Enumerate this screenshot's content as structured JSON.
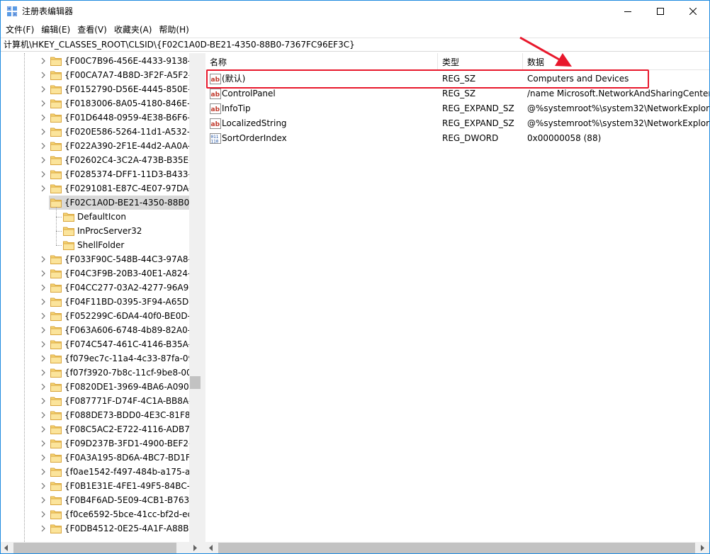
{
  "window": {
    "title": "注册表编辑器",
    "controls": {
      "minimize": "minimize-icon",
      "maximize": "maximize-icon",
      "close": "close-icon"
    }
  },
  "menu": [
    "文件(F)",
    "编辑(E)",
    "查看(V)",
    "收藏夹(A)",
    "帮助(H)"
  ],
  "address": "计算机\\HKEY_CLASSES_ROOT\\CLSID\\{F02C1A0D-BE21-4350-88B0-7367FC96EF3C}",
  "tree": {
    "before": [
      "{F00C7B96-456E-4433-9138-5",
      "{F00CA7A7-4B8D-3F2F-A5F2-C",
      "{F0152790-D56E-4445-850E-4I",
      "{F0183006-8A05-4180-846E-0/",
      "{F01D6448-0959-4E38-B6F6-B",
      "{F020E586-5264-11d1-A532-00",
      "{F022A390-2F1E-44d2-AA0A-0",
      "{F02602C4-3C2A-473B-B35E-6",
      "{F0285374-DFF1-11D3-B433-00",
      "{F0291081-E87C-4E07-97DA-A"
    ],
    "selected": "{F02C1A0D-BE21-4350-88B0-7",
    "children": [
      "DefaultIcon",
      "InProcServer32",
      "ShellFolder"
    ],
    "after": [
      "{F033F90C-548B-44C3-97A8-B",
      "{F04C3F9B-20B3-40E1-A824-3/",
      "{F04CC277-03A2-4277-96A9-7",
      "{F04F11BD-0395-3F94-A65D-C",
      "{F052299C-6DA4-40f0-BE0D-8",
      "{F063A606-6748-4b89-82A0-3I",
      "{F074C547-461C-4146-B35A-F",
      "{f079ec7c-11a4-4c33-87fa-090",
      "{f07f3920-7b8c-11cf-9be8-00a",
      "{F0820DE1-3969-4BA6-A090-E",
      "{F087771F-D74F-4C1A-BB8A-E",
      "{F088DE73-BDD0-4E3C-81F8-6",
      "{F08C5AC2-E722-4116-ADB7-C",
      "{F09D237B-3FD1-4900-BEF2-3/",
      "{F0A3A195-8D6A-4BC7-BD1F-3",
      "{f0ae1542-f497-484b-a175-a2",
      "{F0B1E31E-4FE1-49F5-84BC-4E",
      "{F0B4F6AD-5E09-4CB1-B763-E",
      "{f0ce6592-5bce-41cc-bf2d-ec4",
      "{F0DB4512-0E25-4A1F-A88B-8"
    ]
  },
  "columns": {
    "name": "名称",
    "type": "类型",
    "data": "数据"
  },
  "values": [
    {
      "name": "(默认)",
      "type": "REG_SZ",
      "data": "Computers and Devices",
      "icon": "string-value-icon"
    },
    {
      "name": "ControlPanel",
      "type": "REG_SZ",
      "data": "/name Microsoft.NetworkAndSharingCenter",
      "icon": "string-value-icon"
    },
    {
      "name": "InfoTip",
      "type": "REG_EXPAND_SZ",
      "data": "@%systemroot%\\system32\\NetworkExplore",
      "icon": "string-value-icon"
    },
    {
      "name": "LocalizedString",
      "type": "REG_EXPAND_SZ",
      "data": "@%systemroot%\\system32\\NetworkExplore",
      "icon": "string-value-icon"
    },
    {
      "name": "SortOrderIndex",
      "type": "REG_DWORD",
      "data": "0x00000058 (88)",
      "icon": "binary-value-icon"
    }
  ],
  "colors": {
    "highlight": "#e8182c",
    "selection": "#d9d9d9",
    "window_border": "#1f8be0",
    "folder": "#f8d775"
  }
}
